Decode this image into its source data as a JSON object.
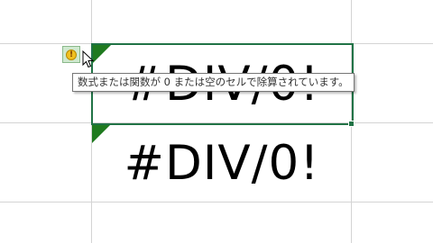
{
  "cells": {
    "cell_a_value": "#DIV/0!",
    "cell_b_value": "#DIV/0!"
  },
  "error_indicator": {
    "icon": "warning-exclamation-icon",
    "symbol": "!",
    "tooltip": "数式または関数が 0 または空のセルで除算されています。"
  },
  "colors": {
    "selection_border": "#217346",
    "error_triangle": "#1f7a1f",
    "gridline": "#d4d4d4"
  }
}
